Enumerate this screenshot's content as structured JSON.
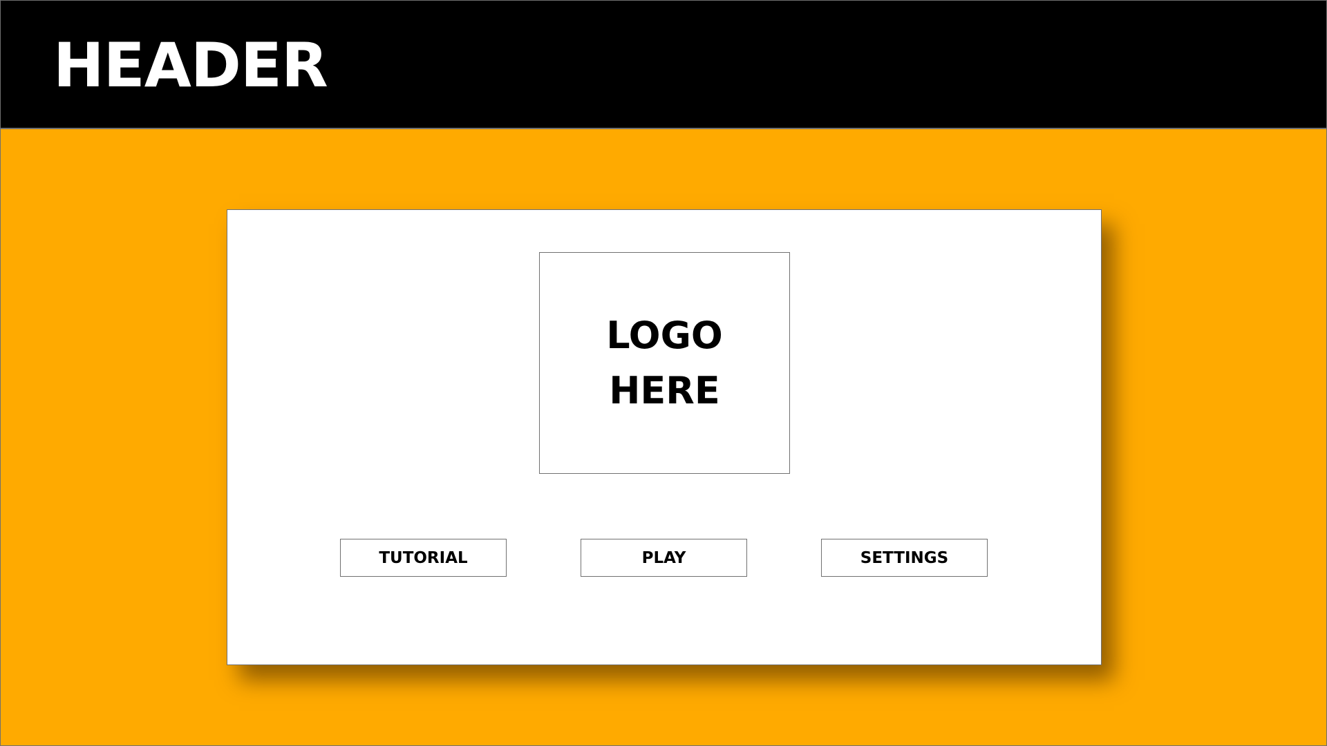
{
  "header": {
    "title": "HEADER"
  },
  "colors": {
    "background": "#FFAA00",
    "header": "#000000",
    "card": "#FFFFFF"
  },
  "card": {
    "logo": {
      "lines": [
        "LOGO",
        "HERE"
      ]
    },
    "buttons": [
      {
        "label": "TUTORIAL"
      },
      {
        "label": "PLAY"
      },
      {
        "label": "SETTINGS"
      }
    ]
  }
}
